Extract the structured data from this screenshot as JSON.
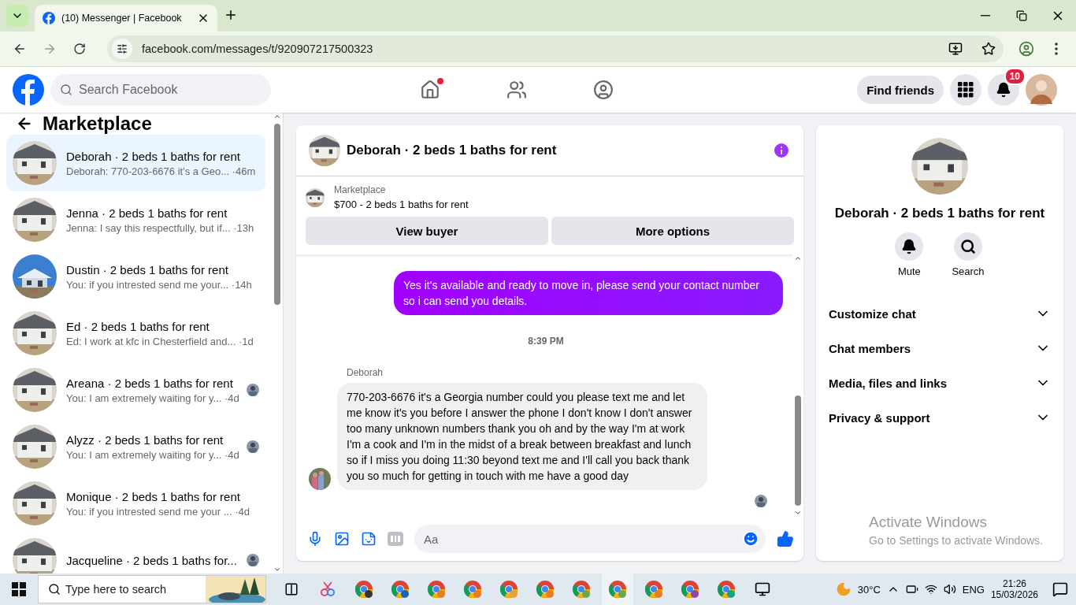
{
  "browser": {
    "tab_title": "(10) Messenger | Facebook",
    "address": "facebook.com/messages/t/920907217500323"
  },
  "header": {
    "search_placeholder": "Search Facebook",
    "home_badge": true,
    "find_friends": "Find friends",
    "notification_count": "10"
  },
  "sidebar": {
    "title": "Marketplace",
    "conversations": [
      {
        "name": "Deborah · 2 beds 1 baths for rent",
        "preview": "Deborah: 770-203-6676 it's a Geo... ·46m",
        "selected": true,
        "seen": false,
        "sky": false
      },
      {
        "name": "Jenna · 2 beds 1 baths for rent",
        "preview": "Jenna: I say this respectfully, but if... ·13h",
        "selected": false,
        "seen": false,
        "sky": false
      },
      {
        "name": "Dustin · 2 beds 1 baths for rent",
        "preview": "You: if you intrested send me your... ·14h",
        "selected": false,
        "seen": false,
        "sky": true
      },
      {
        "name": "Ed · 2 beds 1 baths for rent",
        "preview": "Ed: I work at kfc in Chesterfield and... ·1d",
        "selected": false,
        "seen": false,
        "sky": false
      },
      {
        "name": "Areana · 2 beds 1 baths for rent",
        "preview": "You: I am extremely waiting for y... ·4d",
        "selected": false,
        "seen": true,
        "sky": false
      },
      {
        "name": "Alyzz · 2 beds 1 baths for rent",
        "preview": "You: I am extremely waiting for y... ·4d",
        "selected": false,
        "seen": true,
        "sky": false
      },
      {
        "name": "Monique · 2 beds 1 baths for rent",
        "preview": "You: if you intrested send me your ... ·4d",
        "selected": false,
        "seen": false,
        "sky": false
      },
      {
        "name": "Jacqueline · 2 beds 1 baths for...",
        "selected": false,
        "seen": true,
        "sky": false
      }
    ]
  },
  "chat": {
    "title": "Deborah · 2 beds 1 baths for rent",
    "listing": {
      "label": "Marketplace",
      "text": "$700 - 2 beds 1 baths for rent"
    },
    "buttons": [
      "View buyer",
      "More options"
    ],
    "messages": [
      {
        "kind": "outgoing",
        "text": "Yes it's available and ready to move in, please send your contact number so i can send you details."
      },
      {
        "kind": "timestamp",
        "text": "8:39 PM"
      },
      {
        "kind": "sender",
        "text": "Deborah"
      },
      {
        "kind": "incoming",
        "text": "770-203-6676 it's a Georgia number could you please text me and let me know it's you before I answer the phone I don't know I don't answer too many unknown numbers thank you oh and by the way I'm at work I'm a cook and I'm in the midst of a break between breakfast and lunch so if I miss you doing 11:30 beyond text me and I'll call you back thank you so much for getting in touch with me have a good day"
      }
    ],
    "composer_placeholder": "Aa"
  },
  "details": {
    "title": "Deborah · 2 beds 1 baths for rent",
    "actions": [
      {
        "kind": "mute",
        "label": "Mute"
      },
      {
        "kind": "search",
        "label": "Search"
      }
    ],
    "sections": [
      {
        "label": "Customize chat",
        "expanded": false
      },
      {
        "label": "Chat members",
        "expanded": false
      },
      {
        "label": "Media, files and links",
        "expanded": false
      },
      {
        "label": "Privacy & support",
        "expanded": false
      }
    ]
  },
  "watermark": {
    "title": "Activate Windows",
    "text": "Go to Settings to activate Windows."
  },
  "taskbar": {
    "search_placeholder": "Type here to search",
    "temperature": "30°C",
    "language": "ENG",
    "time": "21:26",
    "date": "15/03/2026"
  }
}
